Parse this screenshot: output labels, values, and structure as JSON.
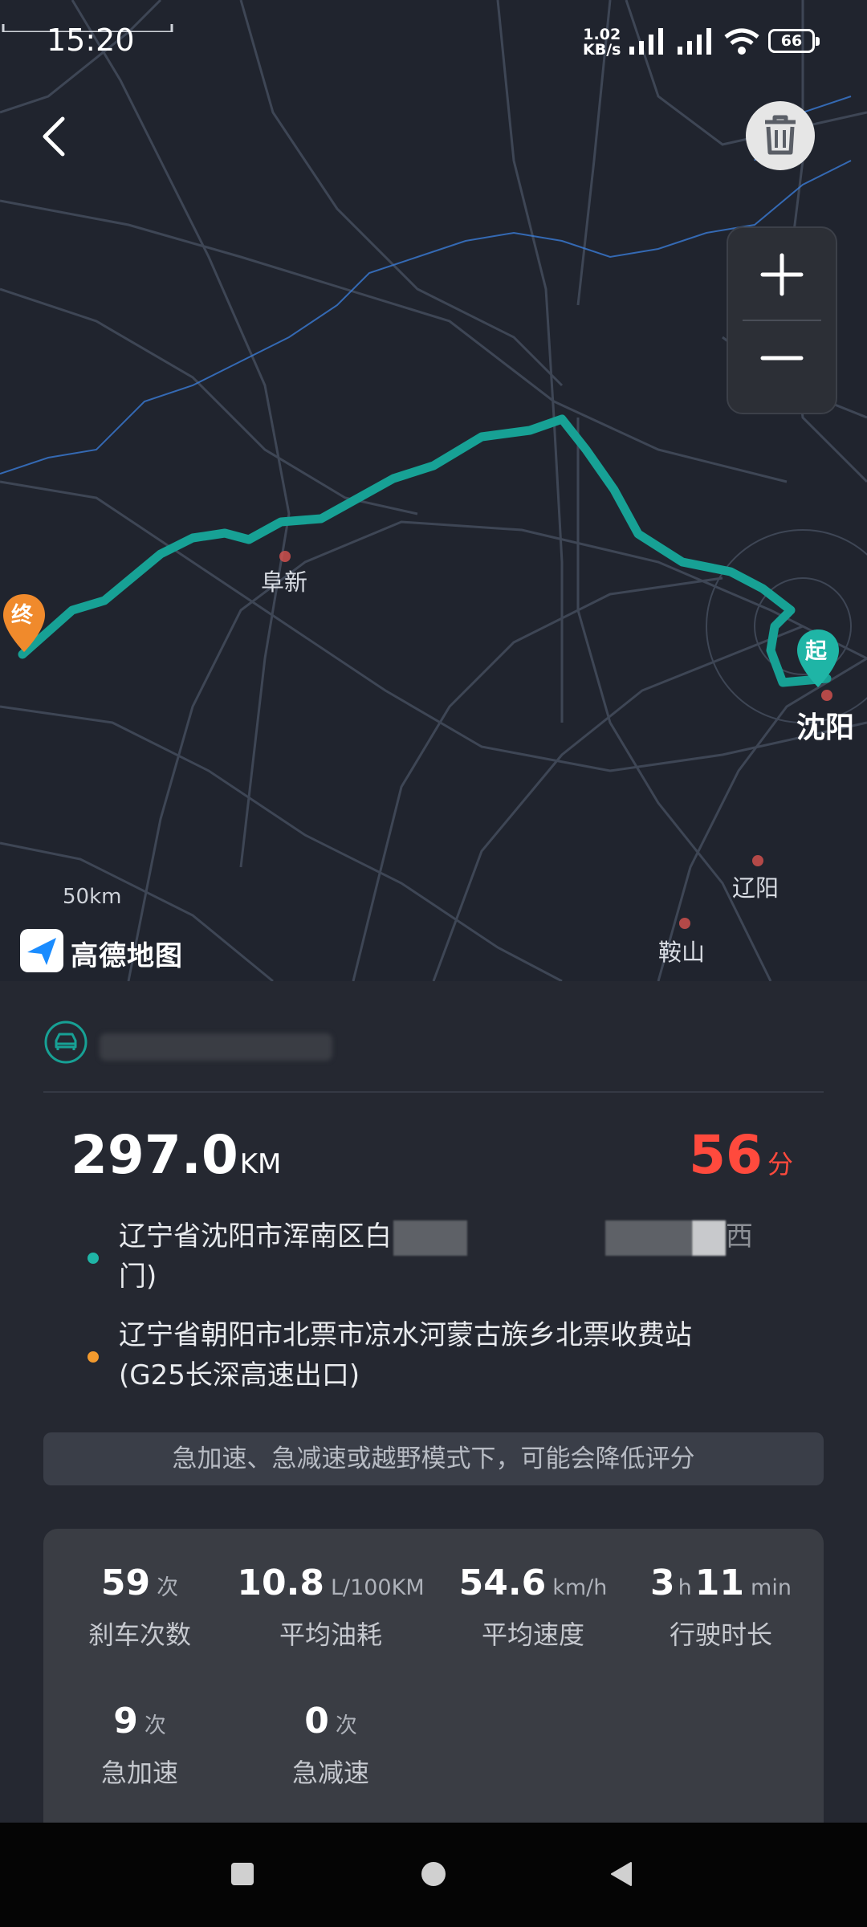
{
  "status_bar": {
    "time": "15:20",
    "network_speed_value": "1.02",
    "network_speed_unit": "KB/s",
    "battery": "66"
  },
  "map": {
    "labels": {
      "fuxin": "阜新",
      "shenyang": "沈阳",
      "liaoyang": "辽阳",
      "anshan": "鞍山"
    },
    "start_marker": "起",
    "end_marker": "终",
    "scale": "50km",
    "provider_logo": "高德地图",
    "route_color": "#17a195"
  },
  "trip": {
    "distance": "297.0",
    "distance_unit": "KM",
    "score": "56",
    "score_unit": "分",
    "start_address": "辽宁省沈阳市浑南区白",
    "start_address_tail": "西",
    "start_address_line2": "门)",
    "end_address": "辽宁省朝阳市北票市凉水河蒙古族乡北票收费站",
    "end_address_line2": "(G25长深高速出口)",
    "notice": "急加速、急减速或越野模式下，可能会降低评分"
  },
  "stats": [
    {
      "value": "59",
      "unit": "次",
      "label": "刹车次数"
    },
    {
      "value": "10.8",
      "unit": "L/100KM",
      "label": "平均油耗"
    },
    {
      "value": "54.6",
      "unit": "km/h",
      "label": "平均速度"
    },
    {
      "value": "3",
      "unit": "h",
      "value2": "11",
      "unit2": "min",
      "label": "行驶时长"
    },
    {
      "value": "9",
      "unit": "次",
      "label": "急加速"
    },
    {
      "value": "0",
      "unit": "次",
      "label": "急减速"
    }
  ],
  "colors": {
    "accent_teal": "#17a195",
    "score_red": "#ff4a3d",
    "start_dot": "#1fb5a6",
    "end_dot": "#f29a2e"
  }
}
